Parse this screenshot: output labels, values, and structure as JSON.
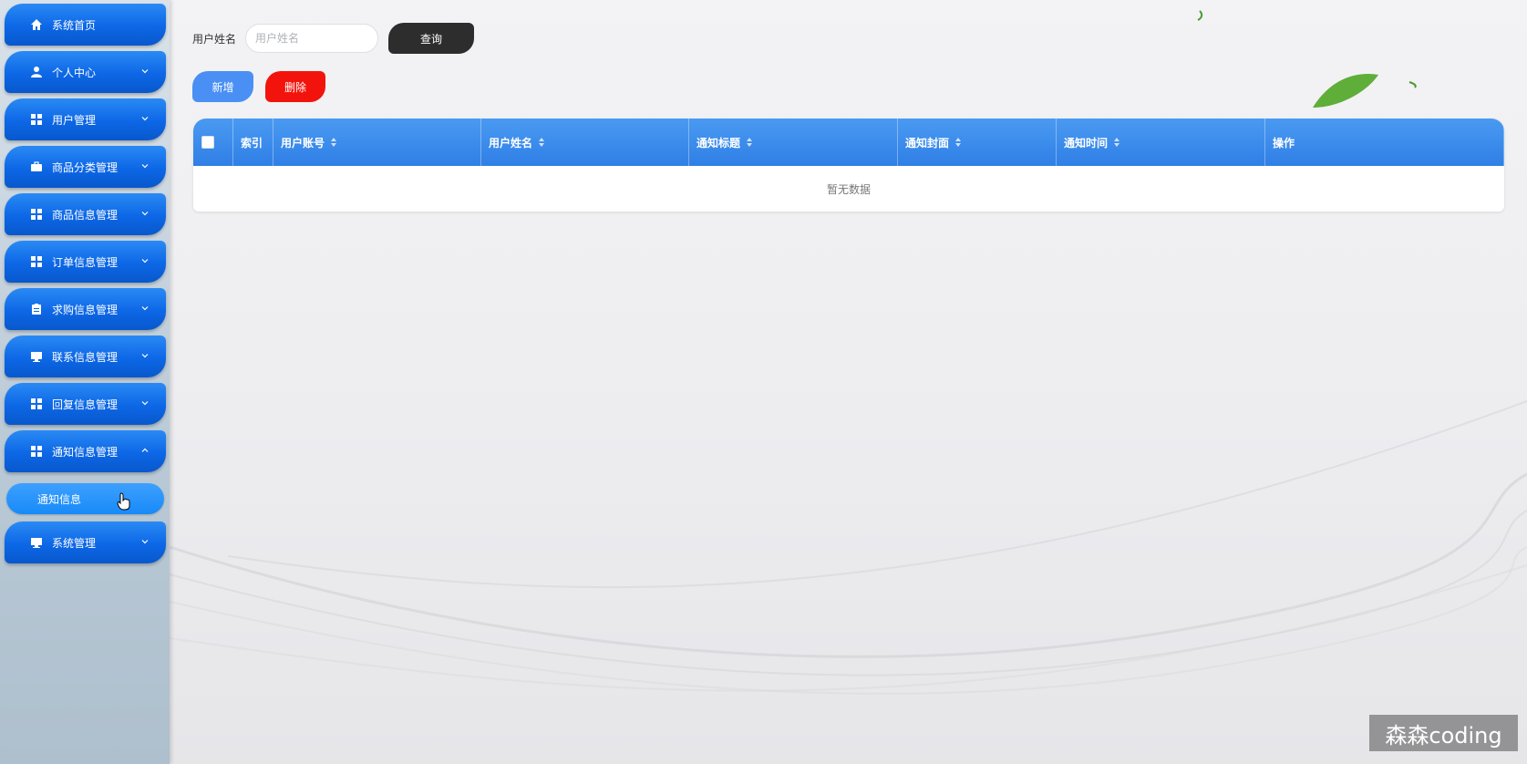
{
  "sidebar": {
    "items": [
      {
        "label": "系统首页",
        "icon": "home-icon",
        "chevron": ""
      },
      {
        "label": "个人中心",
        "icon": "user-icon",
        "chevron": "down"
      },
      {
        "label": "用户管理",
        "icon": "grid-icon",
        "chevron": "down"
      },
      {
        "label": "商品分类管理",
        "icon": "briefcase-icon",
        "chevron": "down"
      },
      {
        "label": "商品信息管理",
        "icon": "grid-icon",
        "chevron": "down"
      },
      {
        "label": "订单信息管理",
        "icon": "grid-icon",
        "chevron": "down"
      },
      {
        "label": "求购信息管理",
        "icon": "clipboard-icon",
        "chevron": "down"
      },
      {
        "label": "联系信息管理",
        "icon": "monitor-icon",
        "chevron": "down"
      },
      {
        "label": "回复信息管理",
        "icon": "grid-icon",
        "chevron": "down"
      },
      {
        "label": "通知信息管理",
        "icon": "grid-icon",
        "chevron": "up"
      },
      {
        "label": "系统管理",
        "icon": "monitor-icon",
        "chevron": "down"
      }
    ],
    "sub_item": {
      "label": "通知信息"
    }
  },
  "search": {
    "label": "用户姓名",
    "placeholder": "用户姓名",
    "value": ""
  },
  "buttons": {
    "query": "查询",
    "add": "新增",
    "delete": "删除"
  },
  "table": {
    "columns": [
      "索引",
      "用户账号",
      "用户姓名",
      "通知标题",
      "通知封面",
      "通知时间",
      "操作"
    ],
    "empty_text": "暂无数据"
  },
  "watermark": "森森coding",
  "colors": {
    "menu_blue": "#0d67e6",
    "sub_blue": "#178af8",
    "query_dark": "#2d2d2d",
    "add_blue": "#4a90f4",
    "delete_red": "#f2140c",
    "table_header": "#3a8bec"
  }
}
